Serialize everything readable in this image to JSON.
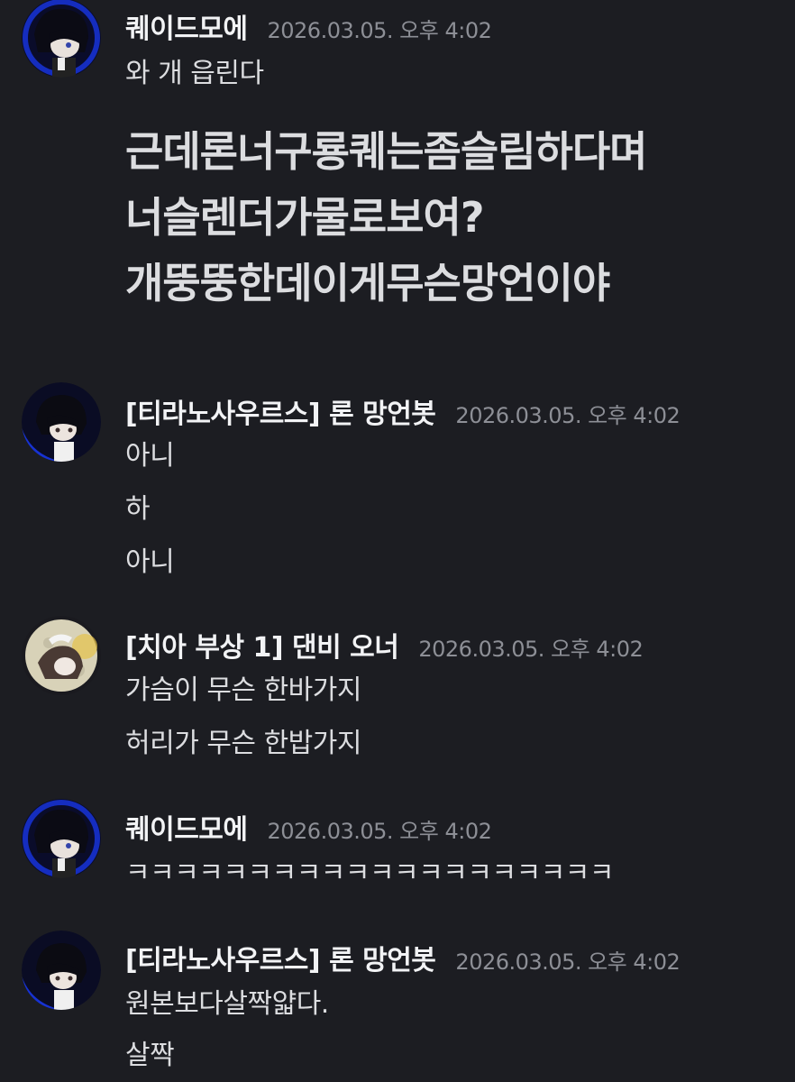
{
  "messages": [
    {
      "username": "퀘이드모에",
      "timestamp": "2026.03.05. 오후 4:02",
      "lines": [
        "와 개 읍린다"
      ],
      "big_lines": [
        "근데론너구룡퀘는좀슬림하다며",
        "너슬렌더가물로보여?",
        "개뚱뚱한데이게무슨망언이야"
      ]
    },
    {
      "username": "[티라노사우르스] 론 망언봇",
      "timestamp": "2026.03.05. 오후 4:02",
      "lines": [
        "아니",
        "하",
        "아니"
      ]
    },
    {
      "username": "[치아 부상 1] 댄비 오너",
      "timestamp": "2026.03.05. 오후 4:02",
      "lines": [
        "가슴이 무슨 한바가지",
        "허리가 무슨 한밥가지"
      ]
    },
    {
      "username": "퀘이드모에",
      "timestamp": "2026.03.05. 오후 4:02",
      "lines": [
        "ㅋㅋㅋㅋㅋㅋㅋㅋㅋㅋㅋㅋㅋㅋㅋㅋㅋㅋㅋㅋ"
      ]
    },
    {
      "username": "[티라노사우르스] 론 망언봇",
      "timestamp": "2026.03.05. 오후 4:02",
      "lines": [
        "원본보다살짝얇다.",
        "살짝"
      ]
    }
  ],
  "colors": {
    "background": "#1c1d22",
    "username": "#f2f3f5",
    "timestamp": "#8d8f96",
    "text": "#dcdde0",
    "avatar_accent": "#1a3cff"
  },
  "icons": [
    "user-avatar-dark",
    "user-avatar-moon"
  ]
}
